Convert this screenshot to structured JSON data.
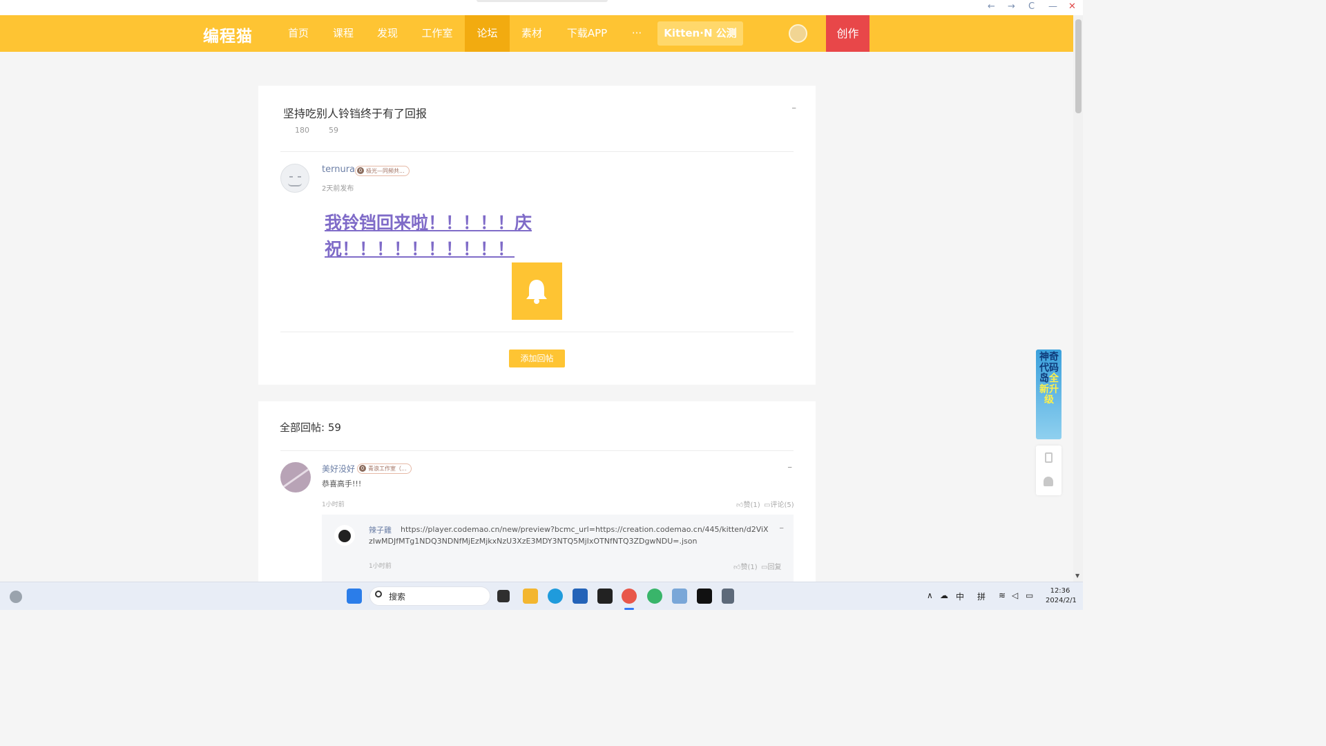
{
  "window": {
    "back": "←",
    "forward": "→",
    "refresh": "C",
    "minimize": "—",
    "close": "✕"
  },
  "nav": {
    "logo": "编程猫",
    "items": [
      "首页",
      "课程",
      "发现",
      "工作室",
      "论坛",
      "素材",
      "下载APP",
      "···"
    ],
    "active_index": 4,
    "kitten_label": "Kitten·N 公测",
    "create_label": "创作"
  },
  "post": {
    "title": "坚持吃别人铃铛终于有了回报",
    "views": "180",
    "replies": "59",
    "more": "--",
    "author": "ternura",
    "author_badge_level": "0",
    "author_badge": "极光—同频共...",
    "time": "2天前发布",
    "headline": "我铃铛回来啦！！！！！庆祝！！！！！！！！！！",
    "add_reply_label": "添加回帖"
  },
  "replies": {
    "title": "全部回帖: 59",
    "items": [
      {
        "name": "美好没好",
        "badge_level": "0",
        "badge": "青浪工作室（...",
        "text": "恭喜高手!!!",
        "time": "1小时前",
        "like": "赞(1)",
        "comment": "评论(5)",
        "more": "--",
        "sub": {
          "name": "辣子雞",
          "text": "https://player.codemao.cn/new/preview?bcmc_url=https://creation.codemao.cn/445/kitten/d2ViXzIwMDJfMTg1NDQ3NDNfMjEzMjkxNzU3XzE3MDY3NTQ5MjIxOTNfNTQ3ZDgwNDU=.json",
          "time": "1小时前",
          "like": "赞(1)",
          "reply": "回复",
          "more": "--"
        }
      }
    ]
  },
  "sidebar": {
    "promo_line1": "神奇代码岛",
    "promo_line2": "全新升级"
  },
  "taskbar": {
    "search_label": "搜索",
    "tray_ime1": "中",
    "tray_ime2": "拼",
    "time": "12:36",
    "date": "2024/2/1"
  },
  "colors": {
    "nav_bg": "#fec433",
    "nav_active": "#f2ab10",
    "create_bg": "#e84749",
    "headline": "#7f6bc8",
    "link_name": "#6c7fa6"
  }
}
